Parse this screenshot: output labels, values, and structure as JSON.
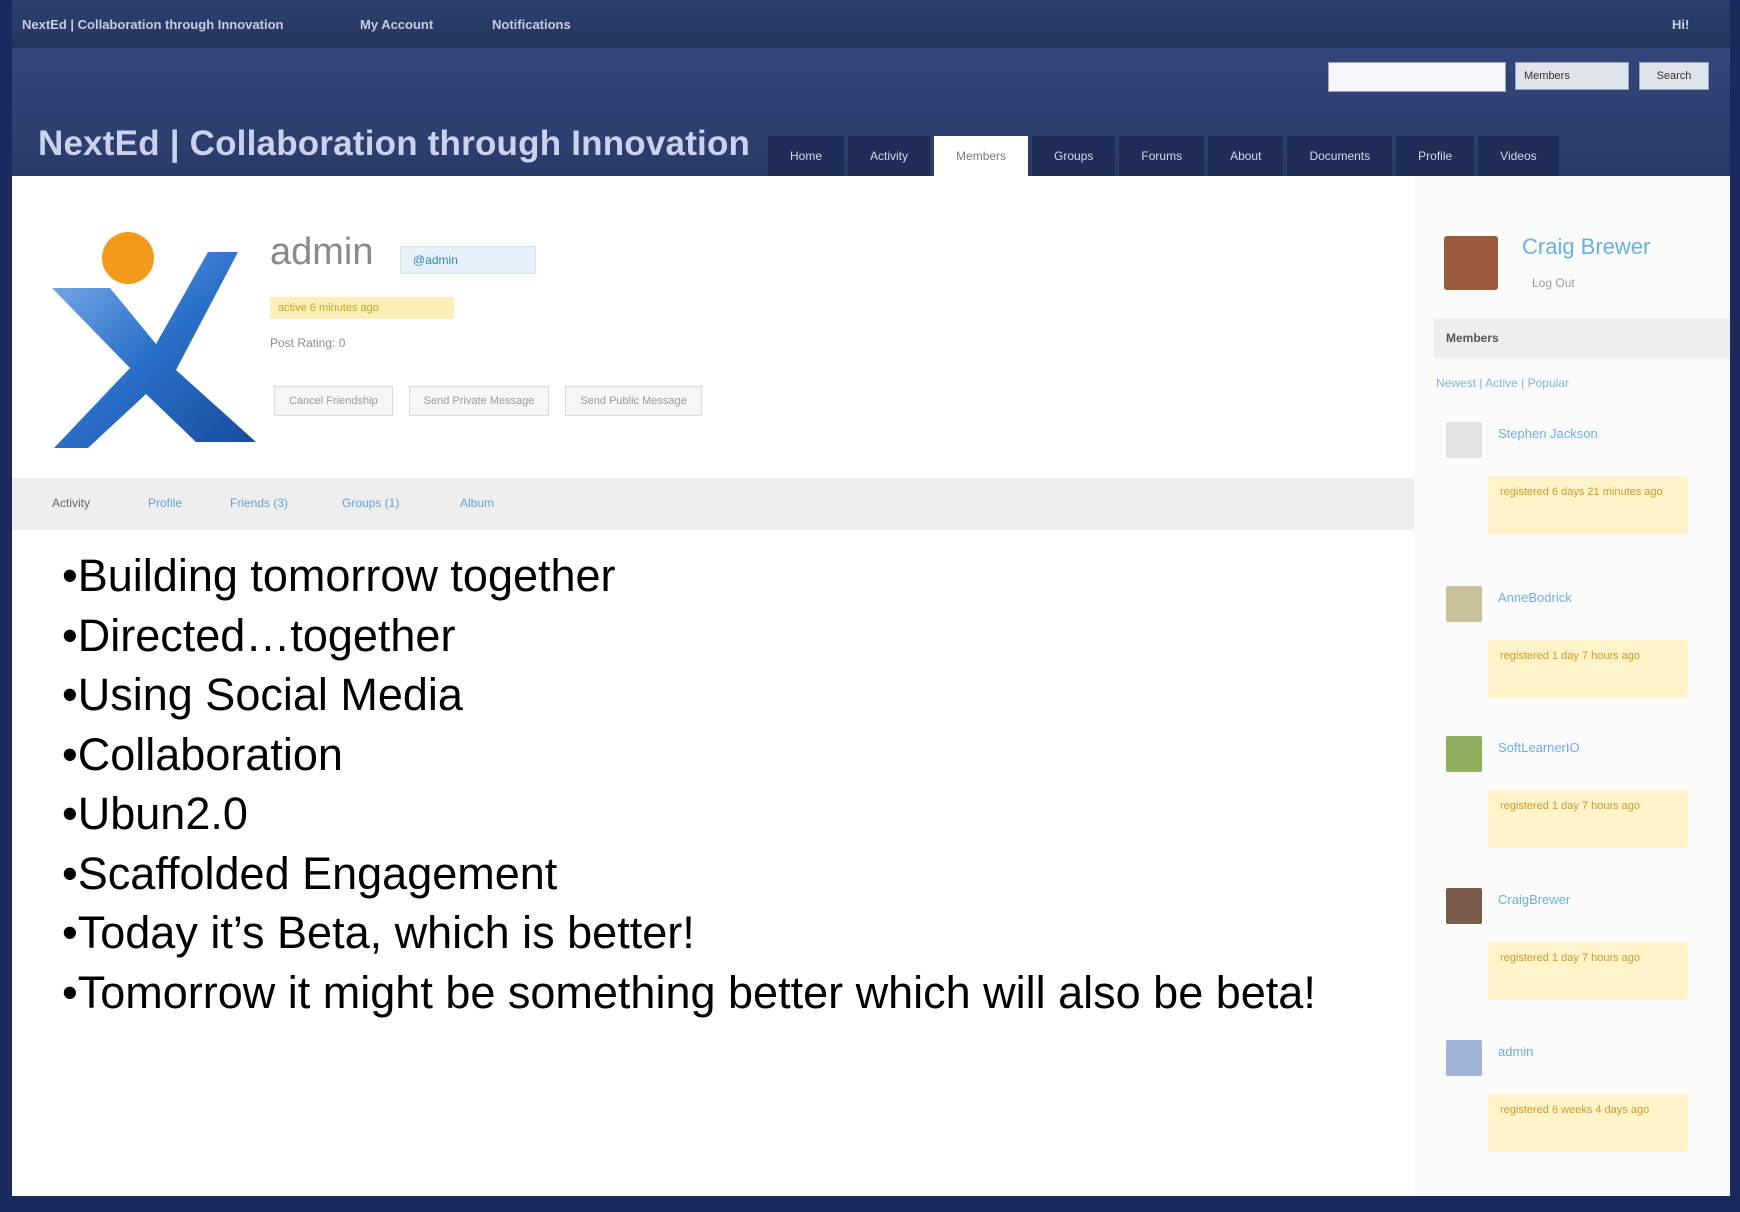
{
  "admin_bar": {
    "site_link": "NextEd | Collaboration through Innovation",
    "my_account": "My Account",
    "notifications": "Notifications",
    "user": "Hi!"
  },
  "header": {
    "site_title": "NextEd | Collaboration through Innovation",
    "search_select": "Members",
    "search_button": "Search",
    "nav_tabs": [
      "Home",
      "Activity",
      "Members",
      "Groups",
      "Forums",
      "About",
      "Documents",
      "Profile",
      "Videos"
    ],
    "active_tab": "Members"
  },
  "profile": {
    "name": "admin",
    "role_badge": "@admin",
    "status_badge": "active 6 minutes ago",
    "rating": "Post Rating: 0",
    "actions": [
      "Cancel Friendship",
      "Send Private Message",
      "Send Public Message"
    ],
    "tabs": [
      "Activity",
      "Profile",
      "Friends (3)",
      "Groups (1)",
      "Album"
    ]
  },
  "content": {
    "bullets": [
      "•Building tomorrow together",
      "•Directed…together",
      "•Using Social Media",
      "•Collaboration",
      "•Ubun2.0",
      "•Scaffolded Engagement",
      "•Today it’s Beta, which is better!",
      "•Tomorrow it might be something better which will also be beta!"
    ]
  },
  "sidebar": {
    "current_user": "Craig Brewer",
    "logout": "Log Out",
    "members_heading": "Members",
    "members_links": "Newest | Active | Popular",
    "members": [
      {
        "name": "Stephen Jackson",
        "note": "registered 6 days 21 minutes ago",
        "avatar_color": "#e2e2e2"
      },
      {
        "name": "AnneBodrick",
        "note": "registered 1 day 7 hours ago",
        "avatar_color": "#c9c19a"
      },
      {
        "name": "SoftLearnerIO",
        "note": "registered 1 day 7 hours ago",
        "avatar_color": "#8fae5e"
      },
      {
        "name": "CraigBrewer",
        "note": "registered 1 day 7 hours ago",
        "avatar_color": "#7a5a48"
      },
      {
        "name": "admin",
        "note": "registered 6 weeks 4 days ago",
        "avatar_color": "#9fb3d6"
      }
    ]
  },
  "colors": {
    "slide_background": "#1b2a5c",
    "header": "#33467a",
    "link": "#6ab0de",
    "highlight": "#fff3c9"
  }
}
